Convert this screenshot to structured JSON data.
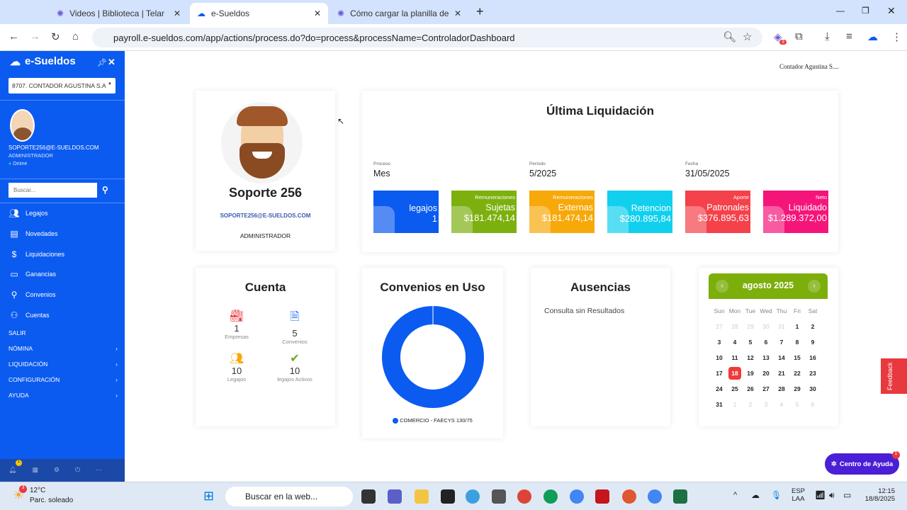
{
  "browser": {
    "tabs": [
      {
        "label": "Videos | Biblioteca | Telar"
      },
      {
        "label": "e-Sueldos"
      },
      {
        "label": "Cómo cargar la planilla de nove"
      }
    ],
    "url": "payroll.e-sueldos.com/app/actions/process.do?do=process&processName=ControladorDashboard",
    "extension_badge": "3"
  },
  "sidebar": {
    "brand": "e-Sueldos",
    "company_select": "8707. CONTADOR AGUSTINA S.A",
    "email": "SOPORTE256@E-SUELDOS.COM",
    "role": "ADMINISTRADOR",
    "status": "Online",
    "search_placeholder": "Buscar...",
    "items": [
      {
        "label": "Legajos",
        "icon": "users-icon"
      },
      {
        "label": "Novedades",
        "icon": "news-icon"
      },
      {
        "label": "Liquidaciones",
        "icon": "dollar-icon"
      },
      {
        "label": "Ganancias",
        "icon": "money-icon"
      },
      {
        "label": "Convenios",
        "icon": "pin-icon"
      },
      {
        "label": "Cuentas",
        "icon": "accounts-icon"
      }
    ],
    "sections": [
      {
        "label": "SALIR"
      },
      {
        "label": "NÓMINA"
      },
      {
        "label": "LIQUIDACIÓN"
      },
      {
        "label": "CONFIGURACIÓN"
      },
      {
        "label": "AYUDA"
      }
    ],
    "notif_badge": "1"
  },
  "header": {
    "user": "Contador Agustina S...."
  },
  "profile": {
    "name": "Soporte 256",
    "email": "SOPORTE256@E-SUELDOS.COM",
    "role": "ADMINISTRADOR"
  },
  "liquidacion": {
    "title": "Última Liquidación",
    "fields": [
      {
        "label": "Proceso",
        "value": "Mes"
      },
      {
        "label": "Período",
        "value": "5/2025"
      },
      {
        "label": "Fecha",
        "value": "31/05/2025"
      }
    ],
    "tiles": [
      {
        "sub": "",
        "main": "legajos",
        "value": "1",
        "color": "#0b5bf0"
      },
      {
        "sub": "Remuneraciones",
        "main": "Sujetas",
        "value": "$181.474,14",
        "color": "#7cb00f"
      },
      {
        "sub": "Remuneraciones",
        "main": "Externas",
        "value": "$181.474,14",
        "color": "#f7a90a"
      },
      {
        "sub": "",
        "main": "Retencion",
        "value": "$280.895,84",
        "color": "#10d0ee"
      },
      {
        "sub": "Aporte",
        "main": "Patronales",
        "value": "$376.895,63",
        "color": "#f4414a"
      },
      {
        "sub": "Neto",
        "main": "Liquidado",
        "value": "$1.289.372,00",
        "color": "#f5157a"
      }
    ]
  },
  "cuenta": {
    "title": "Cuenta",
    "stats": [
      {
        "value": "1",
        "label": "Empresas",
        "icon": "factory-icon",
        "color": "#e8393f"
      },
      {
        "value": "5",
        "label": "Convenios",
        "icon": "document-icon",
        "color": "#0b5bf0"
      },
      {
        "value": "10",
        "label": "Legajos",
        "icon": "group-icon",
        "color": "#f7a90a"
      },
      {
        "value": "10",
        "label": "legajos Activos",
        "icon": "verified-icon",
        "color": "#6aa81c"
      }
    ]
  },
  "convenios": {
    "title": "Convenios en Uso",
    "chart_data": {
      "type": "pie",
      "donut": true,
      "slices": [
        {
          "name": "COMERCIO - FAECYS 130/75",
          "value": 100,
          "color": "#0b5bf0"
        }
      ],
      "legend": "bottom"
    }
  },
  "ausencias": {
    "title": "Ausencias",
    "message": "Consulta sin Resultados"
  },
  "calendar": {
    "month": "agosto 2025",
    "days": [
      "Sun",
      "Mon",
      "Tue",
      "Wed",
      "Thu",
      "Fri",
      "Sat"
    ],
    "today": 18,
    "weeks": [
      [
        "27",
        "28",
        "29",
        "30",
        "31",
        "1",
        "2"
      ],
      [
        "3",
        "4",
        "5",
        "6",
        "7",
        "8",
        "9"
      ],
      [
        "10",
        "11",
        "12",
        "13",
        "14",
        "15",
        "16"
      ],
      [
        "17",
        "18",
        "19",
        "20",
        "21",
        "22",
        "23"
      ],
      [
        "24",
        "25",
        "26",
        "27",
        "28",
        "29",
        "30"
      ],
      [
        "31",
        "1",
        "2",
        "3",
        "4",
        "5",
        "6"
      ]
    ]
  },
  "feedback": "Feedback",
  "help": {
    "label": "Centro de Ayuda",
    "badge": "1"
  },
  "taskbar": {
    "weather_temp": "12°C",
    "weather_desc": "Parc. soleado",
    "weather_badge": "3",
    "search": "Buscar en la web...",
    "lang1": "ESP",
    "lang2": "LAA",
    "time": "12:15",
    "date": "18/8/2025"
  }
}
